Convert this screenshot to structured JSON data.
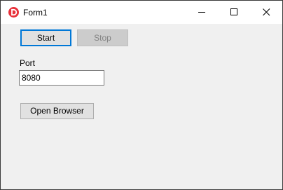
{
  "window": {
    "title": "Form1",
    "icon": "app-logo-icon",
    "controls": [
      "minimize-icon",
      "maximize-icon",
      "close-icon"
    ]
  },
  "buttons": {
    "start_label": "Start",
    "stop_label": "Stop",
    "open_browser_label": "Open Browser"
  },
  "port": {
    "label": "Port",
    "value": "8080"
  },
  "colors": {
    "accent": "#0078d7",
    "logo": "#e8313a",
    "window_bg": "#f0f0f0"
  }
}
